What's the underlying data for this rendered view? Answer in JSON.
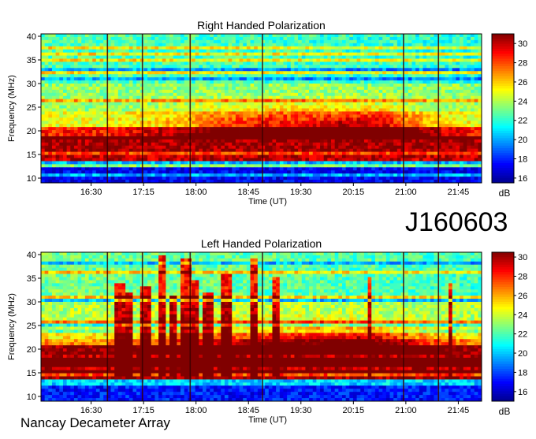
{
  "figure": {
    "observation_id": "J160603",
    "credit": "Nancay Decameter Array"
  },
  "chart_data": [
    {
      "type": "heatmap",
      "title": "Right Handed Polarization",
      "xlabel": "Time (UT)",
      "ylabel": "Frequency (MHz)",
      "x_range": [
        "15:47",
        "22:05"
      ],
      "xticks": [
        "16:30",
        "17:15",
        "18:00",
        "18:45",
        "19:30",
        "20:15",
        "21:00",
        "21:45"
      ],
      "ylim": [
        9,
        40.5
      ],
      "yticks": [
        10,
        15,
        20,
        25,
        30,
        35,
        40
      ],
      "colorbar": {
        "label": "dB",
        "min": 15.5,
        "max": 31,
        "ticks": [
          16,
          18,
          20,
          22,
          24,
          26,
          28,
          30
        ]
      },
      "grid": false,
      "colormap": [
        "#00008f",
        "#0000ff",
        "#0080ff",
        "#00ffff",
        "#80ff80",
        "#ffff00",
        "#ff8000",
        "#ff0000",
        "#800000"
      ]
    },
    {
      "type": "heatmap",
      "title": "Left Handed Polarization",
      "xlabel": "Time (UT)",
      "ylabel": "Frequency (MHz)",
      "x_range": [
        "15:47",
        "22:05"
      ],
      "xticks": [
        "16:30",
        "17:15",
        "18:00",
        "18:45",
        "19:30",
        "20:15",
        "21:00",
        "21:45"
      ],
      "ylim": [
        9,
        40.5
      ],
      "yticks": [
        10,
        15,
        20,
        25,
        30,
        35,
        40
      ],
      "colorbar": {
        "label": "dB",
        "min": 15,
        "max": 30.5,
        "ticks": [
          16,
          18,
          20,
          22,
          24,
          26,
          28,
          30
        ]
      },
      "grid": false,
      "colormap": [
        "#00008f",
        "#0000ff",
        "#0080ff",
        "#00ffff",
        "#80ff80",
        "#ffff00",
        "#ff8000",
        "#ff0000",
        "#800000"
      ]
    }
  ]
}
